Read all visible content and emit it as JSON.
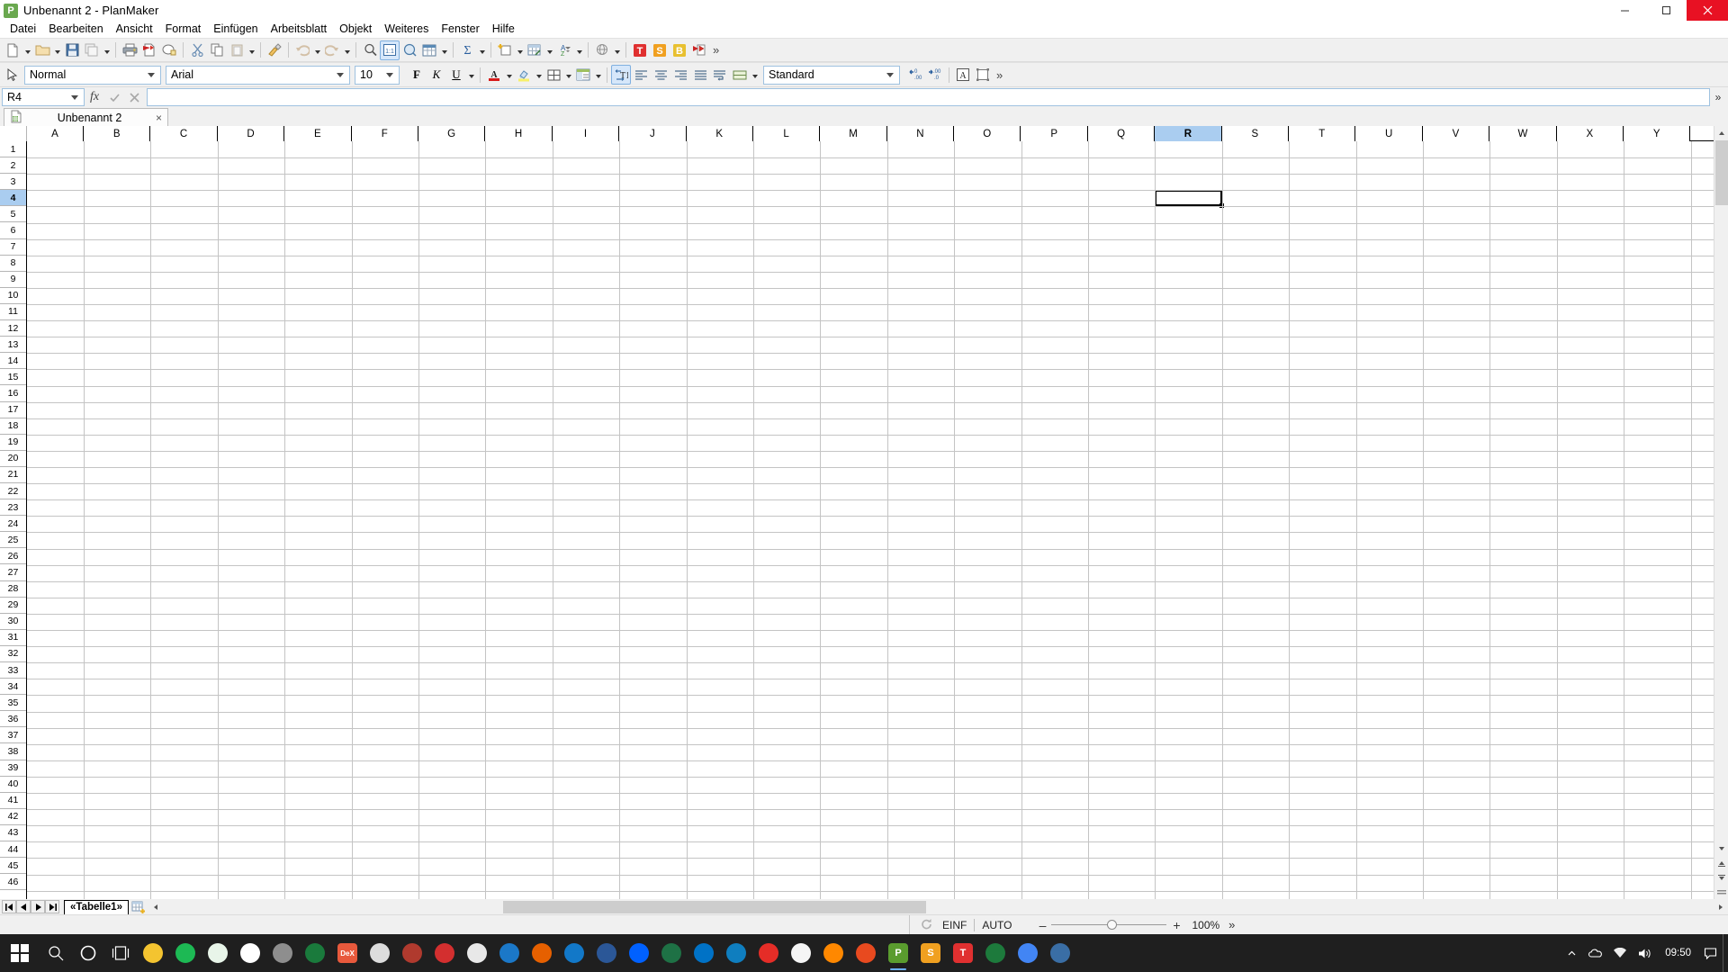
{
  "window": {
    "title": "Unbenannt 2 - PlanMaker",
    "app_icon": "planmaker-icon",
    "minimize": "minimize-icon",
    "maximize": "maximize-icon",
    "close": "close-icon"
  },
  "menubar": {
    "items": [
      {
        "label": "Datei",
        "name": "menu-datei"
      },
      {
        "label": "Bearbeiten",
        "name": "menu-bearbeiten"
      },
      {
        "label": "Ansicht",
        "name": "menu-ansicht"
      },
      {
        "label": "Format",
        "name": "menu-format"
      },
      {
        "label": "Einfügen",
        "name": "menu-einfuegen"
      },
      {
        "label": "Arbeitsblatt",
        "name": "menu-arbeitsblatt"
      },
      {
        "label": "Objekt",
        "name": "menu-objekt"
      },
      {
        "label": "Weiteres",
        "name": "menu-weiteres"
      },
      {
        "label": "Fenster",
        "name": "menu-fenster"
      },
      {
        "label": "Hilfe",
        "name": "menu-hilfe"
      }
    ]
  },
  "toolbar_main": {
    "overflow_label": "»",
    "buttons": [
      {
        "icon": "new-document-icon",
        "dropdown": true
      },
      {
        "icon": "open-folder-icon",
        "dropdown": true
      },
      {
        "icon": "save-icon",
        "dropdown": false
      },
      {
        "icon": "save-all-icon",
        "dropdown": true
      },
      {
        "sep": true
      },
      {
        "icon": "print-icon",
        "dropdown": false
      },
      {
        "icon": "export-pdf-icon",
        "dropdown": false
      },
      {
        "icon": "print-preview-icon",
        "dropdown": false
      },
      {
        "sep": true
      },
      {
        "icon": "cut-scissors-icon",
        "dropdown": false
      },
      {
        "icon": "copy-icon",
        "dropdown": false
      },
      {
        "icon": "paste-icon",
        "dropdown": true
      },
      {
        "sep": true
      },
      {
        "icon": "format-painter-icon",
        "dropdown": false
      },
      {
        "sep": true
      },
      {
        "icon": "undo-icon",
        "dropdown": true
      },
      {
        "icon": "redo-icon",
        "dropdown": true
      },
      {
        "sep": true
      },
      {
        "icon": "search-icon",
        "dropdown": false
      },
      {
        "icon": "zoom-100-icon",
        "dropdown": false,
        "active": true
      },
      {
        "icon": "zoom-region-icon",
        "dropdown": false
      },
      {
        "icon": "table-format-icon",
        "dropdown": true
      },
      {
        "sep": true
      },
      {
        "icon": "autosum-sigma-icon",
        "dropdown": true
      },
      {
        "sep": true
      },
      {
        "icon": "insert-cells-icon",
        "dropdown": true
      },
      {
        "icon": "filter-table-icon",
        "dropdown": true
      },
      {
        "icon": "sort-az-icon",
        "dropdown": true
      },
      {
        "sep": true
      },
      {
        "icon": "globe-hyperlink-icon",
        "dropdown": true
      },
      {
        "sep": true
      },
      {
        "icon": "textmaker-t-icon",
        "color": "#e03030"
      },
      {
        "icon": "presentations-s-icon",
        "color": "#f0a020"
      },
      {
        "icon": "basiceditor-b-icon",
        "color": "#e8c030"
      },
      {
        "icon": "mail-send-icon"
      }
    ]
  },
  "toolbar_format": {
    "pointer_icon": "object-select-icon",
    "paragraph_style": {
      "value": "Normal",
      "name": "paragraph-style-combo"
    },
    "font_name": {
      "value": "Arial",
      "name": "font-name-combo"
    },
    "font_size": {
      "value": "10",
      "name": "font-size-combo"
    },
    "bold": "F",
    "italic": "K",
    "underline": "U",
    "font_color_icon": "font-color-icon",
    "highlight_icon": "highlight-color-icon",
    "borders_icon": "borders-icon",
    "cell-style_icon": "cell-properties-icon",
    "wrap_text_icon": "text-orientation-icon",
    "align_left_icon": "align-left-icon",
    "align_center_icon": "align-center-icon",
    "align_right_icon": "align-right-icon",
    "align_justify_icon": "align-justify-icon",
    "wrap_icon": "wrap-text-icon",
    "merge_cells_icon": "merge-cells-icon",
    "number_format": {
      "value": "Standard",
      "name": "number-format-combo"
    },
    "decrease_decimal_icon": "decrease-decimal-icon",
    "increase_decimal_icon": "increase-decimal-icon",
    "char_format_icon": "character-format-icon",
    "cell_frame_icon": "cell-frame-icon",
    "overflow_label": "»"
  },
  "formulabar": {
    "namebox_value": "R4",
    "fx_label": "fx",
    "accept_icon": "checkmark-icon",
    "cancel_icon": "cancel-x-icon",
    "input_value": "",
    "overflow_label": "»"
  },
  "doctabs": {
    "tabs": [
      {
        "label": "Unbenannt 2",
        "icon": "planmaker-doc-icon",
        "close": "×",
        "active": true
      }
    ]
  },
  "grid": {
    "columns": [
      "A",
      "B",
      "C",
      "D",
      "E",
      "F",
      "G",
      "H",
      "I",
      "J",
      "K",
      "L",
      "M",
      "N",
      "O",
      "P",
      "Q",
      "R",
      "S",
      "T",
      "U",
      "V",
      "W",
      "X",
      "Y"
    ],
    "selected_column": "R",
    "selected_row": 4,
    "active_cell": "R4",
    "rows": [
      1,
      2,
      3,
      4,
      5,
      6,
      7,
      8,
      9,
      10,
      11,
      12,
      13,
      14,
      15,
      16,
      17,
      18,
      19,
      20,
      21,
      22,
      23,
      24,
      25,
      26,
      27,
      28,
      29,
      30,
      31,
      32,
      33,
      34,
      35,
      36,
      37,
      38,
      39,
      40,
      41,
      42,
      43,
      44,
      45,
      46
    ]
  },
  "sheettabs": {
    "nav_first_icon": "nav-first-icon",
    "nav_prev_icon": "nav-prev-icon",
    "nav_next_icon": "nav-next-icon",
    "nav_last_icon": "nav-last-icon",
    "tabs": [
      {
        "label": "«Tabelle1»",
        "active": true
      }
    ],
    "add_sheet_icon": "add-sheet-icon"
  },
  "statusbar": {
    "refresh_icon": "recalculate-icon",
    "insert_mode": "EINF",
    "calc_mode": "AUTO",
    "zoom_out_label": "–",
    "zoom_in_label": "+",
    "zoom_level": "100%",
    "overflow_label": "»"
  },
  "taskbar": {
    "start_icon": "windows-start-icon",
    "search_icon": "search-icon",
    "cortana_icon": "cortana-circle-icon",
    "taskview_icon": "task-view-icon",
    "items": [
      {
        "name": "file-explorer-icon",
        "color": "#f4c430",
        "glyph": ""
      },
      {
        "name": "spotify-icon",
        "color": "#1db954",
        "glyph": ""
      },
      {
        "name": "greenshot-icon",
        "color": "#e8f5e9",
        "glyph": ""
      },
      {
        "name": "qr-app-icon",
        "color": "#ffffff",
        "glyph": ""
      },
      {
        "name": "opera-icon",
        "color": "#8e8e8e",
        "glyph": ""
      },
      {
        "name": "mediaplayer-icon",
        "color": "#1a7a3c",
        "glyph": ""
      },
      {
        "name": "dex-icon",
        "color": "#e8593c",
        "glyph": "DeX"
      },
      {
        "name": "printer-icon",
        "color": "#dcdcdc",
        "glyph": ""
      },
      {
        "name": "ccleaner-icon",
        "color": "#b03a2e",
        "glyph": ""
      },
      {
        "name": "adobe-reader-icon",
        "color": "#d32f2f",
        "glyph": ""
      },
      {
        "name": "notepad-icon",
        "color": "#e8e8e8",
        "glyph": ""
      },
      {
        "name": "teamviewer-icon",
        "color": "#1b78c8",
        "glyph": ""
      },
      {
        "name": "firefox-icon",
        "color": "#e66000",
        "glyph": ""
      },
      {
        "name": "thunderbird-icon",
        "color": "#1278c8",
        "glyph": ""
      },
      {
        "name": "word-doc-icon",
        "color": "#2b5797",
        "glyph": ""
      },
      {
        "name": "dropbox-icon",
        "color": "#0061ff",
        "glyph": ""
      },
      {
        "name": "excel-doc-icon",
        "color": "#1e7145",
        "glyph": ""
      },
      {
        "name": "outlook-icon",
        "color": "#0072c6",
        "glyph": ""
      },
      {
        "name": "edge-icon",
        "color": "#0f7ebf",
        "glyph": ""
      },
      {
        "name": "youtube-icon",
        "color": "#e52d27",
        "glyph": ""
      },
      {
        "name": "paint-icon",
        "color": "#f5f5f5",
        "glyph": ""
      },
      {
        "name": "vlc-icon",
        "color": "#ff8800",
        "glyph": ""
      },
      {
        "name": "softmaker-icon",
        "color": "#e84a1f",
        "glyph": ""
      },
      {
        "name": "planmaker-taskbar-icon",
        "color": "#5a9c2e",
        "glyph": "P",
        "running": true
      },
      {
        "name": "presentations-taskbar-icon",
        "color": "#f0a020",
        "glyph": "S"
      },
      {
        "name": "textmaker-taskbar-icon",
        "color": "#e03030",
        "glyph": "T"
      },
      {
        "name": "kaspersky-icon",
        "color": "#1d7a3c",
        "glyph": ""
      },
      {
        "name": "chrome-icon",
        "color": "#4285f4",
        "glyph": ""
      },
      {
        "name": "settings-icon",
        "color": "#3a6ea5",
        "glyph": ""
      }
    ],
    "tray": {
      "chevron_icon": "show-hidden-icons-icon",
      "onedrive_icon": "onedrive-icon",
      "network_icon": "network-icon",
      "volume_icon": "volume-icon",
      "time": "09:50",
      "date": "",
      "notification_icon": "notifications-icon"
    }
  },
  "colors": {
    "accent": "#aacdf0",
    "close_red": "#e81123",
    "toolbar_bg": "#f0f0f0",
    "grid_line": "#c4c4c4",
    "taskbar_bg": "#1f1f1f"
  }
}
